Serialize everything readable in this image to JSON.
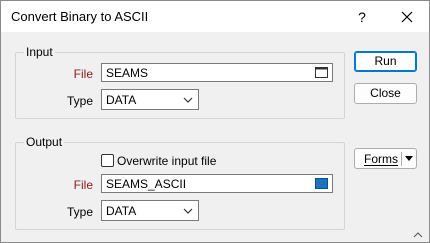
{
  "window": {
    "title": "Convert Binary to ASCII",
    "help_label": "?"
  },
  "input_group": {
    "legend": "Input",
    "file_label": "File",
    "file_value": "SEAMS",
    "type_label": "Type",
    "type_value": "DATA"
  },
  "output_group": {
    "legend": "Output",
    "overwrite_label": "Overwrite input file",
    "overwrite_checked": false,
    "file_label": "File",
    "file_value": "SEAMS_ASCII",
    "type_label": "Type",
    "type_value": "DATA"
  },
  "buttons": {
    "run": "Run",
    "close": "Close",
    "forms": "Forms"
  },
  "colors": {
    "required_label": "#8b1a1a",
    "accent": "#0078d4",
    "file_icon_filled": "#1e73be"
  },
  "icons": {
    "file_browse": "file-browse-icon",
    "file_new": "file-new-icon",
    "close": "close-icon",
    "dropdown": "chevron-down-icon"
  }
}
